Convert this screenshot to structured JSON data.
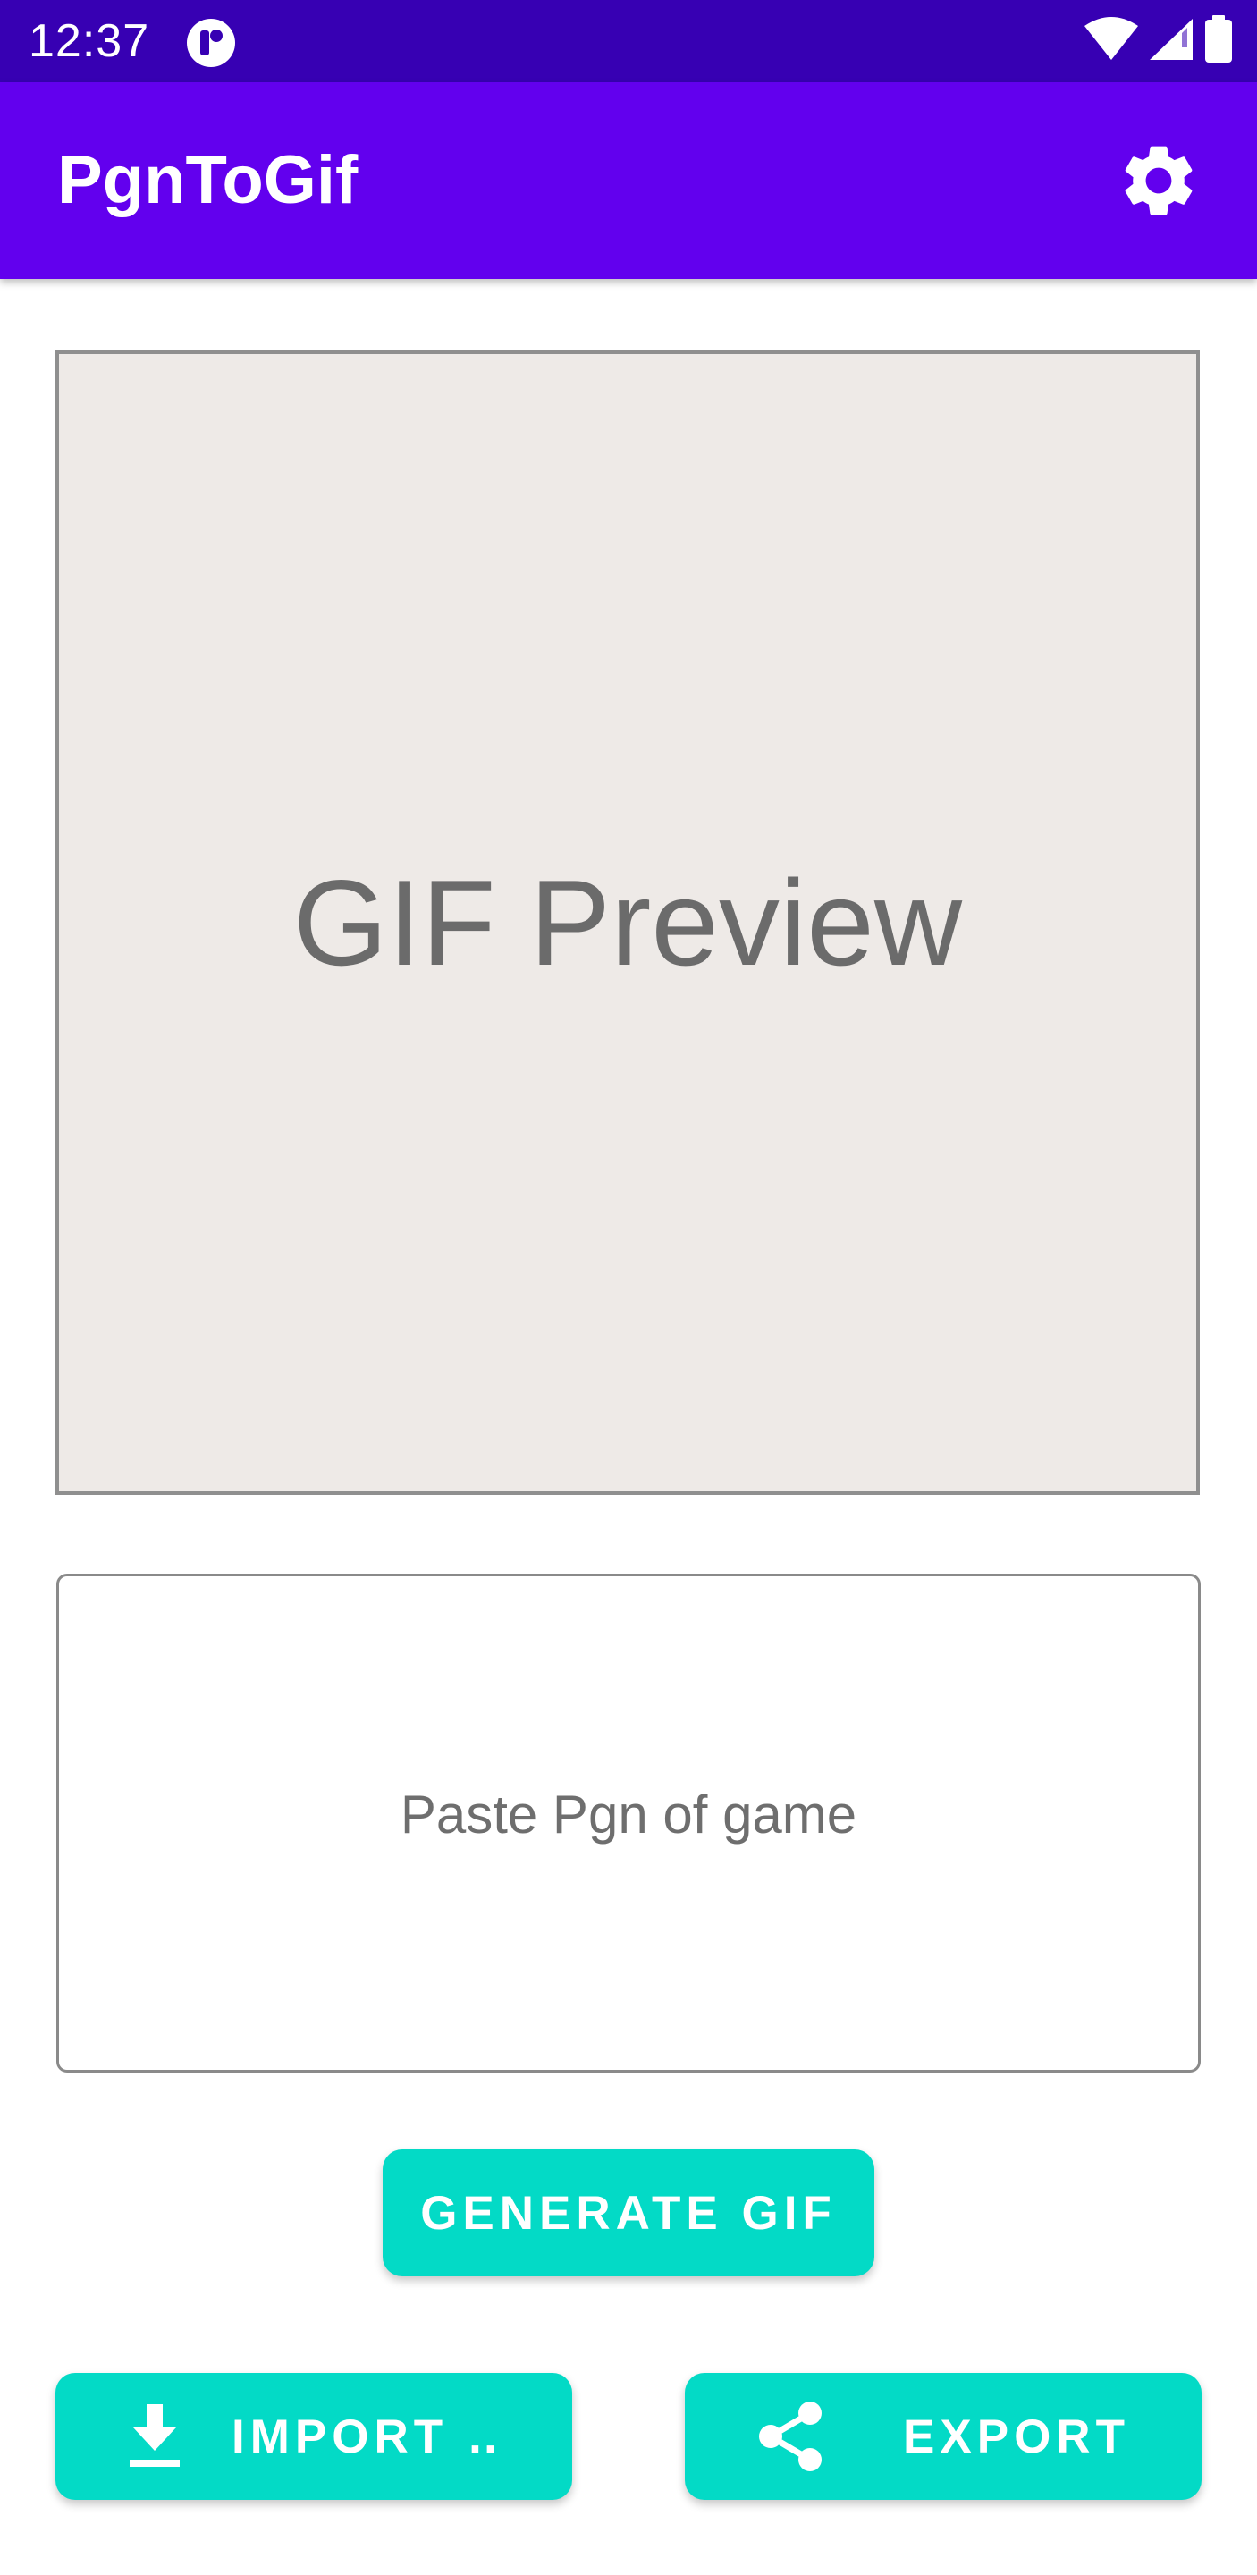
{
  "status_bar": {
    "time": "12:37",
    "background": "#3700B3",
    "icons": [
      "app-notification-icon",
      "wifi-icon",
      "cell-signal-icon",
      "battery-icon"
    ]
  },
  "app_bar": {
    "title": "PgnToGif",
    "background": "#6200EE",
    "action_icon": "gear-icon"
  },
  "preview": {
    "label": "GIF Preview",
    "background": "#EEEAE7"
  },
  "pgn_input": {
    "value": "",
    "placeholder": "Paste Pgn of game"
  },
  "buttons": {
    "generate": "GENERATE GIF",
    "import": "IMPORT …",
    "import_icon": "download-icon",
    "export": "EXPORT",
    "export_icon": "share-icon",
    "color": "#03DAC6"
  }
}
